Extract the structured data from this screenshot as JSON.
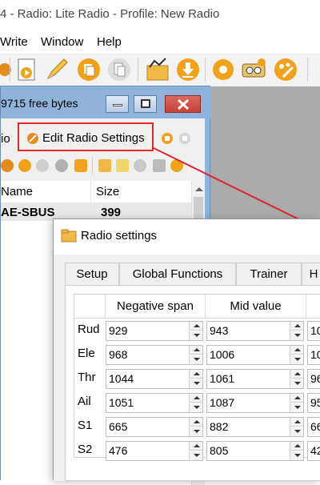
{
  "app": {
    "title": "4 - Radio: Lite Radio - Profile: New Radio"
  },
  "menu": [
    "Write",
    "Window",
    "Help"
  ],
  "mdi": {
    "title": "9715 free bytes",
    "toolbar": {
      "left_label": "io",
      "edit_settings_label": "Edit Radio Settings"
    },
    "list": {
      "headers": [
        "Name",
        "Size"
      ],
      "rows": [
        {
          "name": "AE-SBUS",
          "size": "399"
        }
      ]
    }
  },
  "dialog": {
    "title": "Radio settings",
    "tabs": [
      "Setup",
      "Global Functions",
      "Trainer",
      "H"
    ],
    "active_tab": 0,
    "columns": [
      "Negative span",
      "Mid value"
    ],
    "rows": [
      {
        "label": "Rud",
        "neg": "929",
        "mid": "943",
        "pos": "10"
      },
      {
        "label": "Ele",
        "neg": "968",
        "mid": "1006",
        "pos": "10"
      },
      {
        "label": "Thr",
        "neg": "1044",
        "mid": "1061",
        "pos": "96"
      },
      {
        "label": "Ail",
        "neg": "1051",
        "mid": "1087",
        "pos": "95"
      },
      {
        "label": "S1",
        "neg": "665",
        "mid": "882",
        "pos": "66"
      },
      {
        "label": "S2",
        "neg": "476",
        "mid": "805",
        "pos": "42"
      }
    ]
  },
  "colors": {
    "highlight": "#e0262c",
    "mdi_title": "#8fb3d9",
    "close": "#c9413a"
  }
}
